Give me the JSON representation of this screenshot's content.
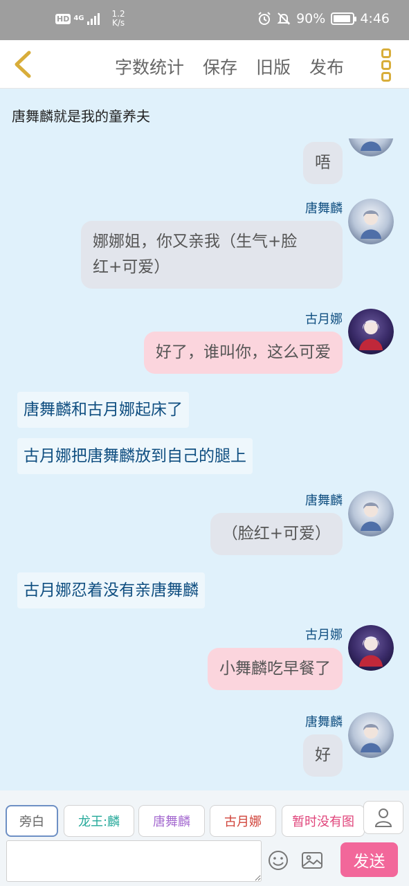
{
  "status_bar": {
    "network_hd": "HD",
    "network_type": "4G",
    "speed_value": "1.2",
    "speed_unit": "K/s",
    "battery": "90%",
    "battery_level": 0.9,
    "time": "4:46"
  },
  "header": {
    "actions": [
      "字数统计",
      "保存",
      "旧版",
      "发布"
    ]
  },
  "story_title": "唐舞麟就是我的童养夫",
  "messages": [
    {
      "type": "bubble",
      "speaker": "唐舞麟",
      "name_visible": false,
      "text": "唔",
      "color": "gray"
    },
    {
      "type": "bubble",
      "speaker": "唐舞麟",
      "text": "娜娜姐，你又亲我（生气+脸红+可爱）",
      "line1": "娜娜姐，你又亲我（生气+脸",
      "line2": "红+可爱）",
      "color": "gray"
    },
    {
      "type": "bubble",
      "speaker": "古月娜",
      "text": "好了，谁叫你，这么可爱",
      "color": "pink"
    },
    {
      "type": "narration",
      "text": "唐舞麟和古月娜起床了"
    },
    {
      "type": "narration",
      "text": "古月娜把唐舞麟放到自己的腿上"
    },
    {
      "type": "bubble",
      "speaker": "唐舞麟",
      "text": "（脸红+可爱）",
      "color": "gray"
    },
    {
      "type": "narration",
      "text": "古月娜忍着没有亲唐舞麟"
    },
    {
      "type": "bubble",
      "speaker": "古月娜",
      "text": "小舞麟吃早餐了",
      "color": "pink"
    },
    {
      "type": "bubble",
      "speaker": "唐舞麟",
      "text": "好",
      "color": "gray"
    }
  ],
  "role_bar": {
    "roles": [
      {
        "label": "旁白",
        "color": "#666666",
        "selected": true
      },
      {
        "label": "龙王:麟",
        "color": "#26a99a",
        "selected": false
      },
      {
        "label": "唐舞麟",
        "color": "#a56bd0",
        "selected": false
      },
      {
        "label": "古月娜",
        "color": "#d0433a",
        "selected": false
      },
      {
        "label": "暂时没有图",
        "color": "#e0457b",
        "selected": false
      }
    ],
    "person_icon": "person-icon"
  },
  "input_bar": {
    "placeholder": "",
    "value": "",
    "send_label": "发送",
    "emoji_icon": "emoji-icon",
    "image_icon": "image-icon"
  },
  "colors": {
    "background": "#e0f1fb",
    "accent_send": "#f2679a",
    "name_color": "#0f4e80",
    "pink_bubble": "#fbd5dd",
    "gray_bubble": "#e2e5ec"
  }
}
